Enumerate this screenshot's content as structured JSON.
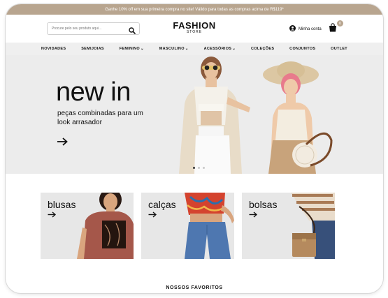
{
  "promo": {
    "text": "Ganhe 10% off em sua primeira compra no site! Válido para todas as compras acima de R$119*"
  },
  "header": {
    "search_placeholder": "Procure pelo seu produto aqui...",
    "logo_main": "FASHION",
    "logo_sub": "STORE",
    "account_label": "Minha conta",
    "cart_count": "0"
  },
  "nav": {
    "items": [
      {
        "label": "NOVIDADES",
        "dropdown": false
      },
      {
        "label": "SEMIJOIAS",
        "dropdown": false
      },
      {
        "label": "FEMININO",
        "dropdown": true
      },
      {
        "label": "MASCULINO",
        "dropdown": true
      },
      {
        "label": "ACESSÓRIOS",
        "dropdown": true
      },
      {
        "label": "COLEÇÕES",
        "dropdown": false
      },
      {
        "label": "CONJUNTOS",
        "dropdown": false
      },
      {
        "label": "OUTLET",
        "dropdown": false
      }
    ]
  },
  "hero": {
    "title": "new in",
    "subtitle": "peças combinadas para um look arrasador",
    "slides": 3,
    "active_slide": 1
  },
  "categories": [
    {
      "label": "blusas"
    },
    {
      "label": "calças"
    },
    {
      "label": "bolsas"
    }
  ],
  "section_title": "NOSSOS FAVORITOS",
  "colors": {
    "accent": "#b8a58f",
    "nav_bg": "#efefef",
    "hero_bg": "#ececec"
  }
}
